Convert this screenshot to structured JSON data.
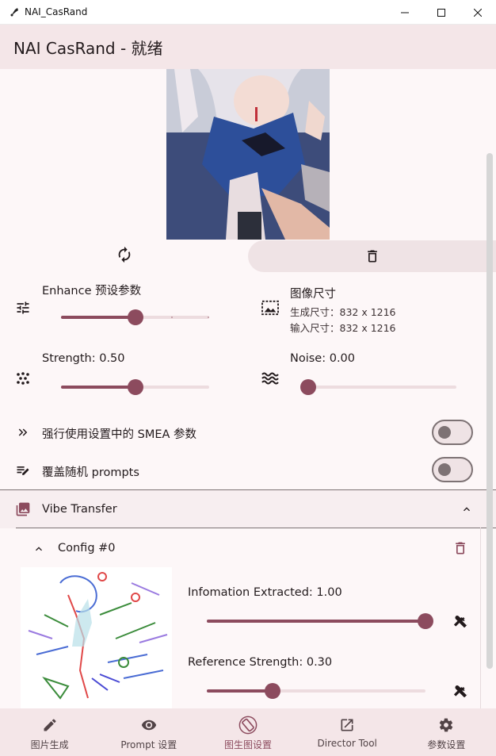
{
  "window": {
    "title": "NAI_CasRand"
  },
  "appbar": {
    "title": "NAI CasRand - 就绪"
  },
  "enhance": {
    "label": "Enhance 预设参数",
    "value_fraction": 0.5
  },
  "image_size": {
    "title": "图像尺寸",
    "generated": "生成尺寸：832 x 1216",
    "input": "输入尺寸：832 x 1216"
  },
  "strength": {
    "label": "Strength: 0.50",
    "value": 0.5
  },
  "noise": {
    "label": "Noise: 0.00",
    "value": 0.0
  },
  "smea": {
    "label": "强行使用设置中的 SMEA 参数",
    "on": false
  },
  "override_prompts": {
    "label": "覆盖随机 prompts",
    "on": false
  },
  "vibe": {
    "title": "Vibe Transfer",
    "config_title": "Config #0",
    "info_extracted": {
      "label": "Infomation Extracted: 1.00",
      "value": 1.0
    },
    "reference_strength": {
      "label": "Reference Strength: 0.30",
      "value": 0.3
    }
  },
  "nav": [
    {
      "label": "图片生成",
      "icon": "pencil-icon"
    },
    {
      "label": "Prompt 设置",
      "icon": "eye-icon"
    },
    {
      "label": "图生图设置",
      "icon": "rotate-screen-icon"
    },
    {
      "label": "Director Tool",
      "icon": "open-external-icon"
    },
    {
      "label": "参数设置",
      "icon": "gear-icon"
    }
  ],
  "colors": {
    "accent": "#8c4b5e",
    "appbar": "#f4e6e8",
    "background": "#fdf7f8"
  }
}
